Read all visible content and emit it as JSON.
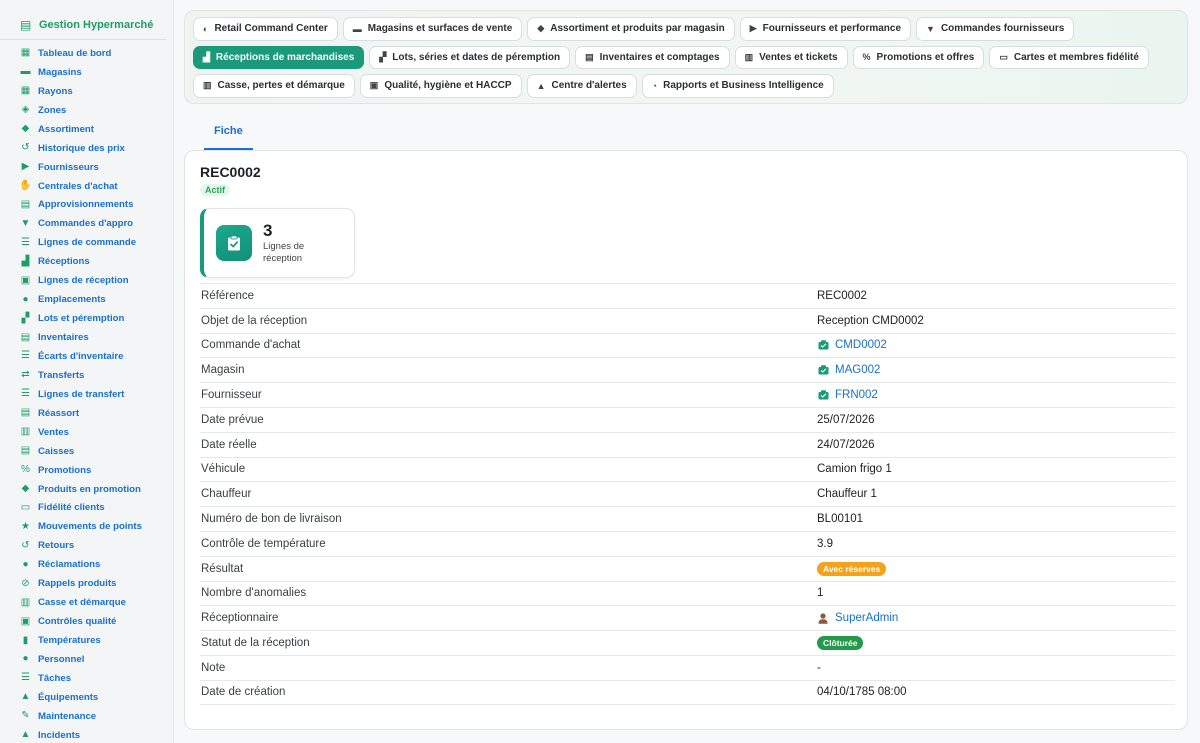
{
  "sidebar": {
    "brand": "Gestion Hypermarché",
    "brand_icon": "cash-register-icon",
    "items": [
      {
        "label": "Tableau de bord",
        "icon": "dashboard-icon"
      },
      {
        "label": "Magasins",
        "icon": "store-icon"
      },
      {
        "label": "Rayons",
        "icon": "grid-icon"
      },
      {
        "label": "Zones",
        "icon": "layers-icon"
      },
      {
        "label": "Assortiment",
        "icon": "tags-icon"
      },
      {
        "label": "Historique des prix",
        "icon": "history-icon"
      },
      {
        "label": "Fournisseurs",
        "icon": "truck-icon"
      },
      {
        "label": "Centrales d'achat",
        "icon": "handshake-icon"
      },
      {
        "label": "Approvisionnements",
        "icon": "clipboard-icon"
      },
      {
        "label": "Commandes d'appro",
        "icon": "cart-icon"
      },
      {
        "label": "Lignes de commande",
        "icon": "list-icon"
      },
      {
        "label": "Réceptions",
        "icon": "dolly-icon"
      },
      {
        "label": "Lignes de réception",
        "icon": "clipboard-check-icon"
      },
      {
        "label": "Emplacements",
        "icon": "location-pin-icon"
      },
      {
        "label": "Lots et péremption",
        "icon": "boxes-icon"
      },
      {
        "label": "Inventaires",
        "icon": "clipboard-list-icon"
      },
      {
        "label": "Écarts d'inventaire",
        "icon": "list-icon"
      },
      {
        "label": "Transferts",
        "icon": "exchange-icon"
      },
      {
        "label": "Lignes de transfert",
        "icon": "list-icon"
      },
      {
        "label": "Réassort",
        "icon": "clipboard-icon"
      },
      {
        "label": "Ventes",
        "icon": "receipt-icon"
      },
      {
        "label": "Caisses",
        "icon": "cash-register-icon"
      },
      {
        "label": "Promotions",
        "icon": "percent-icon"
      },
      {
        "label": "Produits en promotion",
        "icon": "tag-icon"
      },
      {
        "label": "Fidélité clients",
        "icon": "id-card-icon"
      },
      {
        "label": "Mouvements de points",
        "icon": "star-icon"
      },
      {
        "label": "Retours",
        "icon": "undo-icon"
      },
      {
        "label": "Réclamations",
        "icon": "comment-icon"
      },
      {
        "label": "Rappels produits",
        "icon": "ban-icon"
      },
      {
        "label": "Casse et démarque",
        "icon": "trash-icon"
      },
      {
        "label": "Contrôles qualité",
        "icon": "clipboard-check-icon"
      },
      {
        "label": "Températures",
        "icon": "thermometer-icon"
      },
      {
        "label": "Personnel",
        "icon": "user-icon"
      },
      {
        "label": "Tâches",
        "icon": "tasks-icon"
      },
      {
        "label": "Équipements",
        "icon": "plug-icon"
      },
      {
        "label": "Maintenance",
        "icon": "wrench-icon"
      },
      {
        "label": "Incidents",
        "icon": "warning-icon"
      }
    ]
  },
  "topnav": {
    "rows": [
      [
        {
          "label": "Retail Command Center",
          "icon": "gauge-icon"
        },
        {
          "label": "Magasins et surfaces de vente",
          "icon": "store-icon"
        },
        {
          "label": "Assortiment et produits par magasin",
          "icon": "tags-icon"
        },
        {
          "label": "Fournisseurs et performance",
          "icon": "truck-icon"
        },
        {
          "label": "Commandes fournisseurs",
          "icon": "cart-icon"
        }
      ],
      [
        {
          "label": "Réceptions de marchandises",
          "icon": "dolly-icon",
          "active": true
        },
        {
          "label": "Lots, séries et dates de péremption",
          "icon": "boxes-icon"
        },
        {
          "label": "Inventaires et comptages",
          "icon": "clipboard-icon"
        },
        {
          "label": "Ventes et tickets",
          "icon": "receipt-icon"
        },
        {
          "label": "Promotions et offres",
          "icon": "percent-icon"
        },
        {
          "label": "Cartes et membres fidélité",
          "icon": "id-card-icon"
        }
      ],
      [
        {
          "label": "Casse, pertes et démarque",
          "icon": "trash-icon"
        },
        {
          "label": "Qualité, hygiène et HACCP",
          "icon": "clipboard-check-icon"
        },
        {
          "label": "Centre d'alertes",
          "icon": "bell-icon"
        },
        {
          "label": "Rapports et Business Intelligence",
          "icon": "pie-chart-icon"
        }
      ]
    ]
  },
  "tabs": [
    {
      "label": "Fiche",
      "active": true
    }
  ],
  "record": {
    "title": "REC0002",
    "status_badge": "Actif",
    "stat": {
      "value": "3",
      "label": "Lignes de réception",
      "icon": "clipboard-check-icon"
    }
  },
  "fields": {
    "reference": {
      "label": "Référence",
      "value": "REC0002"
    },
    "objet": {
      "label": "Objet de la réception",
      "value": "Reception CMD0002"
    },
    "commande": {
      "label": "Commande d'achat",
      "value": "CMD0002"
    },
    "magasin": {
      "label": "Magasin",
      "value": "MAG002"
    },
    "fournisseur": {
      "label": "Fournisseur",
      "value": "FRN002"
    },
    "date_prevue": {
      "label": "Date prévue",
      "value": "25/07/2026"
    },
    "date_reelle": {
      "label": "Date réelle",
      "value": "24/07/2026"
    },
    "vehicule": {
      "label": "Véhicule",
      "value": "Camion frigo 1"
    },
    "chauffeur": {
      "label": "Chauffeur",
      "value": "Chauffeur 1"
    },
    "bon_livraison": {
      "label": "Numéro de bon de livraison",
      "value": "BL00101"
    },
    "temperature": {
      "label": "Contrôle de température",
      "value": "3.9"
    },
    "resultat": {
      "label": "Résultat",
      "value": "Avec réserves",
      "color": "#f3a31b"
    },
    "anomalies": {
      "label": "Nombre d'anomalies",
      "value": "1"
    },
    "receptionnaire": {
      "label": "Réceptionnaire",
      "value": "SuperAdmin"
    },
    "statut": {
      "label": "Statut de la réception",
      "value": "Clôturée",
      "color": "#239a4a"
    },
    "note": {
      "label": "Note",
      "value": "-"
    },
    "date_creation": {
      "label": "Date de création",
      "value": "04/10/1785 08:00"
    }
  },
  "colors": {
    "accent": "#1a9a7a",
    "link": "#1a6fd0",
    "brand": "#1e9e64"
  }
}
